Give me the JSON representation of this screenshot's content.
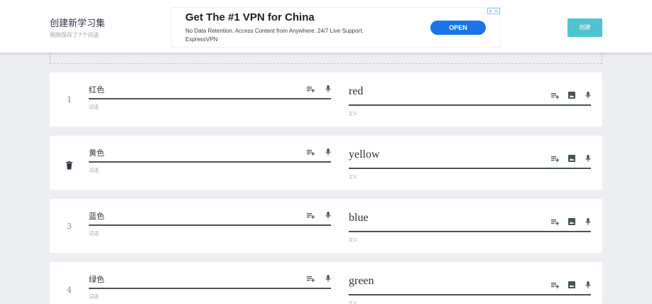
{
  "header": {
    "title": "创建新学习集",
    "subtitle": "刚刚保存了7个词语",
    "create_label": "创建"
  },
  "ad": {
    "headline": "Get The #1 VPN for China",
    "description": "No Data Retention. Access Content from Anywhere. 24/7 Live Support.",
    "advertiser": "ExpressVPN",
    "cta_label": "OPEN",
    "choices_icon": "ad-choices-icon"
  },
  "cards": [
    {
      "index": "1",
      "term": "红色",
      "term_label": "词语",
      "definition": "red",
      "definition_label": "定义"
    },
    {
      "index": "",
      "term": "黄色",
      "term_label": "词语",
      "definition": "yellow",
      "definition_label": "定义"
    },
    {
      "index": "3",
      "term": "蓝色",
      "term_label": "词语",
      "definition": "blue",
      "definition_label": "定义"
    },
    {
      "index": "4",
      "term": "绿色",
      "term_label": "词语",
      "definition": "green",
      "definition_label": "定义"
    }
  ],
  "icons": {
    "list": "playlist-add-icon",
    "mic": "mic-icon",
    "image": "image-icon",
    "delete": "trash-icon"
  },
  "colors": {
    "accent": "#4fc4cf",
    "ad_button": "#1a73e8",
    "background": "#eceef1"
  }
}
